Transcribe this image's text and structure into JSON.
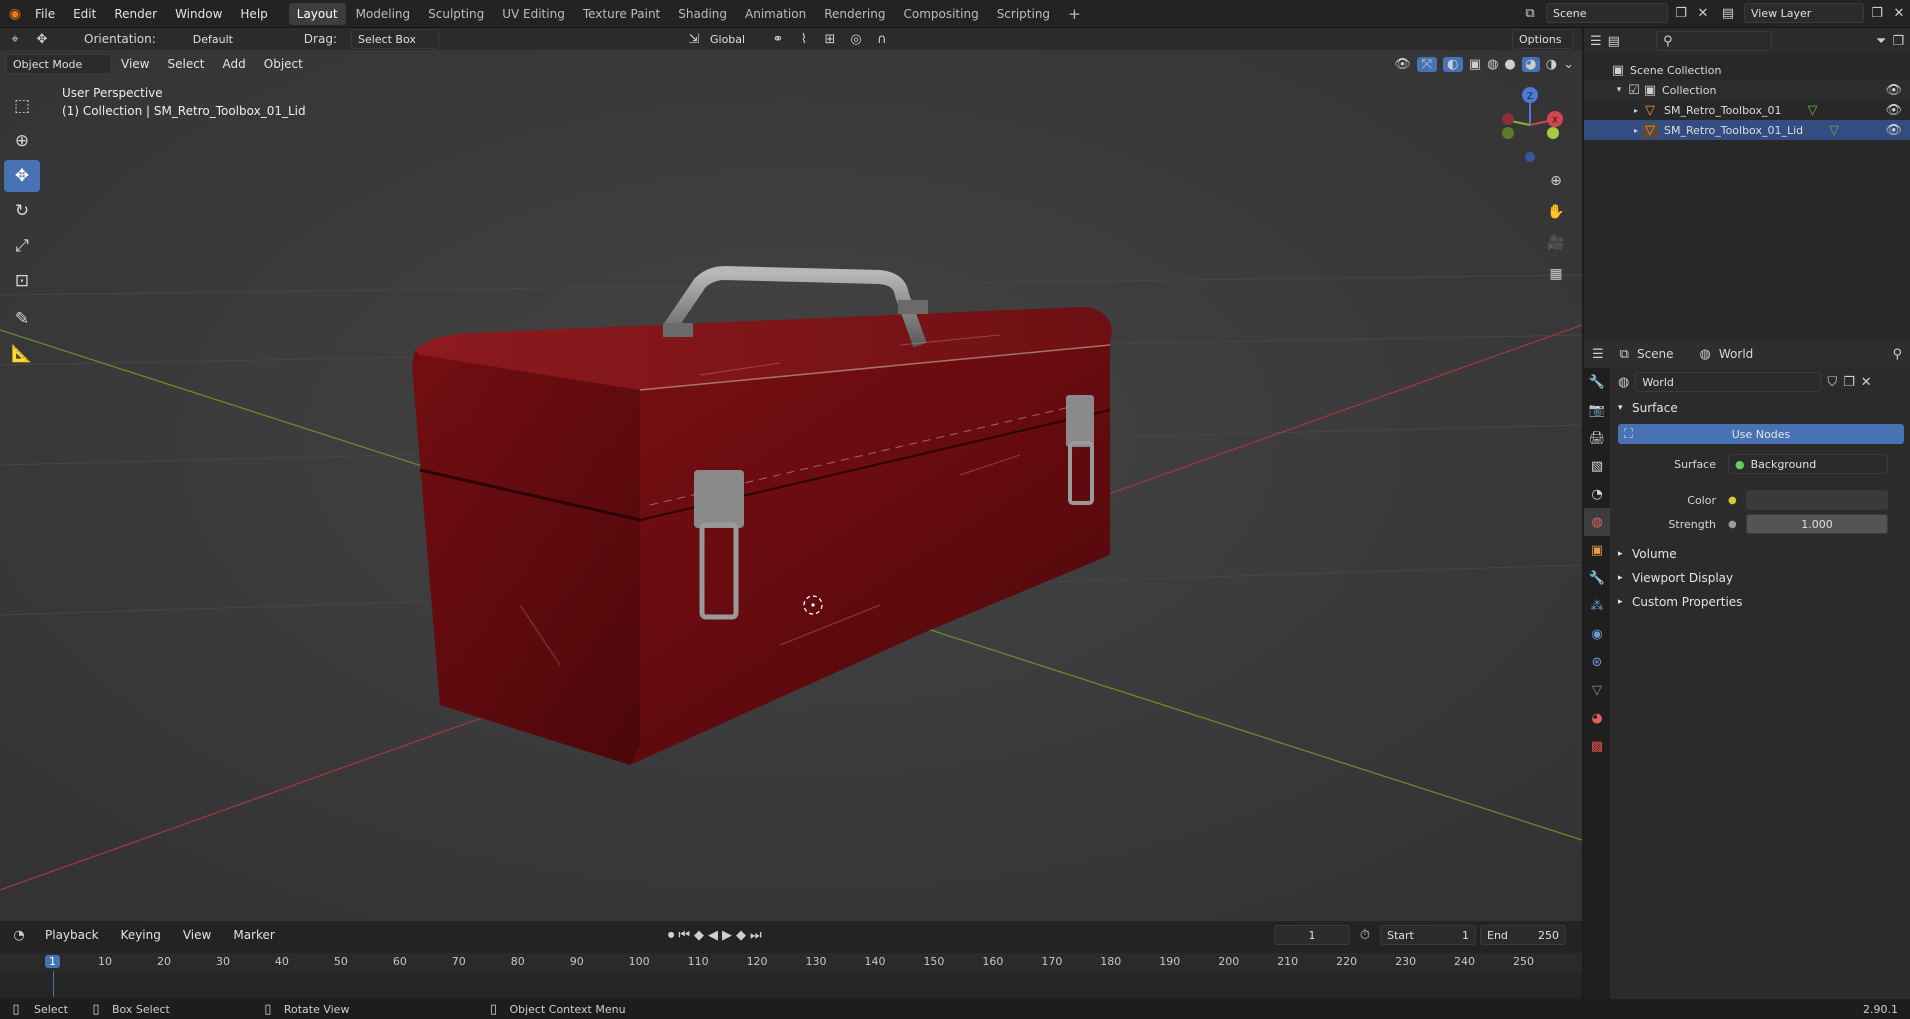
{
  "topbar": {
    "menus": [
      "File",
      "Edit",
      "Render",
      "Window",
      "Help"
    ],
    "workspaces": [
      "Layout",
      "Modeling",
      "Sculpting",
      "UV Editing",
      "Texture Paint",
      "Shading",
      "Animation",
      "Rendering",
      "Compositing",
      "Scripting"
    ],
    "active_workspace": "Layout",
    "add_tab": "+",
    "scene_value": "Scene",
    "view_layer_value": "View Layer"
  },
  "header": {
    "orientation_label": "Orientation:",
    "orientation_value": "Default",
    "drag_label": "Drag:",
    "drag_value": "Select Box",
    "transform_value": "Global",
    "options_label": "Options",
    "mode_value": "Object Mode",
    "menu_view": "View",
    "menu_select": "Select",
    "menu_add": "Add",
    "menu_object": "Object"
  },
  "viewport": {
    "perspective_text": "User Perspective",
    "collection_text": "(1) Collection | SM_Retro_Toolbox_01_Lid",
    "gizmo": {
      "x": "X",
      "y": "Y",
      "z": "Z"
    }
  },
  "outliner": {
    "root": "Scene Collection",
    "collection": "Collection",
    "objects": [
      "SM_Retro_Toolbox_01",
      "SM_Retro_Toolbox_01_Lid"
    ]
  },
  "properties": {
    "crumb_scene": "Scene",
    "crumb_world": "World",
    "world_name": "World",
    "surface_panel": "Surface",
    "use_nodes_label": "Use Nodes",
    "surface_label": "Surface",
    "surface_value": "Background",
    "color_label": "Color",
    "strength_label": "Strength",
    "strength_value": "1.000",
    "panels_collapsed": [
      "Volume",
      "Viewport Display",
      "Custom Properties"
    ],
    "version": "2.90.1"
  },
  "timeline": {
    "menu_playback": "Playback",
    "menu_keying": "Keying",
    "menu_view": "View",
    "menu_marker": "Marker",
    "current_frame": "1",
    "start_label": "Start",
    "start_value": "1",
    "end_label": "End",
    "end_value": "250",
    "ruler_marks": [
      "1",
      "10",
      "20",
      "30",
      "40",
      "50",
      "60",
      "70",
      "80",
      "90",
      "100",
      "110",
      "120",
      "130",
      "140",
      "150",
      "160",
      "170",
      "180",
      "190",
      "200",
      "210",
      "220",
      "230",
      "240",
      "250"
    ]
  },
  "statusbar": {
    "select": "Select",
    "box_select": "Box Select",
    "rotate_view": "Rotate View",
    "context_menu": "Object Context Menu"
  },
  "colors": {
    "accent": "#4772b3",
    "toolbox_red": "#7a0f12",
    "x_axis": "#c6474f",
    "y_axis": "#8bb431"
  }
}
